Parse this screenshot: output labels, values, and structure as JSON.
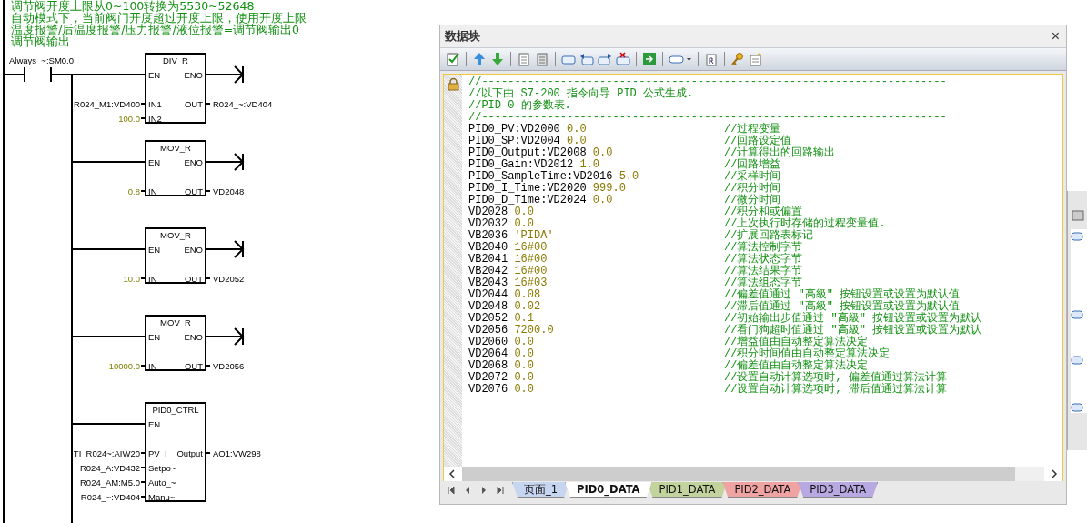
{
  "ladder": {
    "comments": [
      "调节阀开度上限从0~100转换为5530~52648",
      "自动模式下，当前阀门开度超过开度上限，使用开度上限",
      "温度报警/后温度报警/压力报警/液位报警=调节阀输出0",
      "调节阀输出"
    ],
    "contact_label": "Always_~:SM0.0",
    "boxes": [
      {
        "title": "DIV_R",
        "en": "EN",
        "eno": "ENO",
        "inputs": [
          {
            "pin": "IN1",
            "operand": "R024_M1:VD400",
            "kind": "address"
          },
          {
            "pin": "IN2",
            "operand": "100.0",
            "kind": "constant"
          }
        ],
        "output": {
          "pin": "OUT",
          "operand": "R024_~:VD404"
        }
      },
      {
        "title": "MOV_R",
        "en": "EN",
        "eno": "ENO",
        "inputs": [
          {
            "pin": "IN",
            "operand": "0.8",
            "kind": "constant"
          }
        ],
        "output": {
          "pin": "OUT",
          "operand": "VD2048"
        }
      },
      {
        "title": "MOV_R",
        "en": "EN",
        "eno": "ENO",
        "inputs": [
          {
            "pin": "IN",
            "operand": "10.0",
            "kind": "constant"
          }
        ],
        "output": {
          "pin": "OUT",
          "operand": "VD2052"
        }
      },
      {
        "title": "MOV_R",
        "en": "EN",
        "eno": "ENO",
        "inputs": [
          {
            "pin": "IN",
            "operand": "10000.0",
            "kind": "constant"
          }
        ],
        "output": {
          "pin": "OUT",
          "operand": "VD2056"
        }
      },
      {
        "title": "PID0_CTRL",
        "en": "EN",
        "inputs": [
          {
            "pin": "PV_I",
            "operand": "TI_R024~:AIW20",
            "kind": "address"
          },
          {
            "pin": "Setpo~",
            "operand": "R024_A:VD432",
            "kind": "address"
          },
          {
            "pin": "Auto_~",
            "operand": "R024_AM:M5.0",
            "kind": "address"
          },
          {
            "pin": "Manu~",
            "operand": "R024_~:VD404",
            "kind": "address"
          }
        ],
        "output": {
          "pin": "Output",
          "operand": "AO1:VW298"
        }
      }
    ]
  },
  "data_block": {
    "title": "数据块",
    "close": "×",
    "lines": [
      {
        "kind": "comment",
        "text": "//-----------------------------------------------------------------------"
      },
      {
        "kind": "comment",
        "text": "//以下由 S7-200 指令向导 PID 公式生成."
      },
      {
        "kind": "comment",
        "text": "//PID 0 的参数表."
      },
      {
        "kind": "comment",
        "text": "//-----------------------------------------------------------------------"
      },
      {
        "kind": "entry",
        "address": "PID0_PV:VD2000",
        "value": "0.0",
        "comment": "//过程变量"
      },
      {
        "kind": "entry",
        "address": "PID0_SP:VD2004",
        "value": "0.0",
        "comment": "//回路设定值"
      },
      {
        "kind": "entry",
        "address": "PID0_Output:VD2008",
        "value": "0.0",
        "comment": "//计算得出的回路输出"
      },
      {
        "kind": "entry",
        "address": "PID0_Gain:VD2012",
        "value": "1.0",
        "comment": "//回路增益"
      },
      {
        "kind": "entry",
        "address": "PID0_SampleTime:VD2016",
        "value": "5.0",
        "comment": "//采样时间"
      },
      {
        "kind": "entry",
        "address": "PID0_I_Time:VD2020",
        "value": "999.0",
        "comment": "//积分时间"
      },
      {
        "kind": "entry",
        "address": "PID0_D_Time:VD2024",
        "value": "0.0",
        "comment": "//微分时间"
      },
      {
        "kind": "entry",
        "address": "VD2028",
        "value": "0.0",
        "comment": "//积分和或偏置"
      },
      {
        "kind": "entry",
        "address": "VD2032",
        "value": "0.0",
        "comment": "//上次执行时存储的过程变量值."
      },
      {
        "kind": "entry",
        "address": "VB2036",
        "value": "'PIDA'",
        "comment": "//扩展回路表标记"
      },
      {
        "kind": "entry",
        "address": "VB2040",
        "value": "16#00",
        "comment": "//算法控制字节"
      },
      {
        "kind": "entry",
        "address": "VB2041",
        "value": "16#00",
        "comment": "//算法状态字节"
      },
      {
        "kind": "entry",
        "address": "VB2042",
        "value": "16#00",
        "comment": "//算法结果字节"
      },
      {
        "kind": "entry",
        "address": "VB2043",
        "value": "16#03",
        "comment": "//算法组态字节"
      },
      {
        "kind": "entry",
        "address": "VD2044",
        "value": "0.08",
        "comment": "//偏差值通过 \"高級\" 按钮设置或设置为默认值"
      },
      {
        "kind": "entry",
        "address": "VD2048",
        "value": "0.02",
        "comment": "//滞后值通过 \"高級\" 按钮设置或设置为默认值"
      },
      {
        "kind": "entry",
        "address": "VD2052",
        "value": "0.1",
        "comment": "//初始输出步值通过 \"高級\" 按钮设置或设置为默认"
      },
      {
        "kind": "entry",
        "address": "VD2056",
        "value": "7200.0",
        "comment": "//看门狗超时值通过 \"高級\" 按钮设置或设置为默认"
      },
      {
        "kind": "entry",
        "address": "VD2060",
        "value": "0.0",
        "comment": "//增益值由自动整定算法决定"
      },
      {
        "kind": "entry",
        "address": "VD2064",
        "value": "0.0",
        "comment": "//积分时间值由自动整定算法决定"
      },
      {
        "kind": "entry",
        "address": "VD2068",
        "value": "0.0",
        "comment": "//偏差值由自动整定算法决定"
      },
      {
        "kind": "entry",
        "address": "VD2072",
        "value": "0.0",
        "comment": "//设置自动计算选项时, 偏差值通过算法计算"
      },
      {
        "kind": "entry",
        "address": "VD2076",
        "value": "0.0",
        "comment": "//设置自动计算选项时, 滞后值通过算法计算"
      }
    ],
    "tabs": [
      {
        "label": "页面_1",
        "selected": false,
        "color": "#c6d6f0"
      },
      {
        "label": "PID0_DATA",
        "selected": true,
        "color": "#ffffff"
      },
      {
        "label": "PID1_DATA",
        "selected": false,
        "color": "#c3d39e"
      },
      {
        "label": "PID2_DATA",
        "selected": false,
        "color": "#f0a3a3"
      },
      {
        "label": "PID3_DATA",
        "selected": false,
        "color": "#b9a9e2"
      }
    ]
  }
}
